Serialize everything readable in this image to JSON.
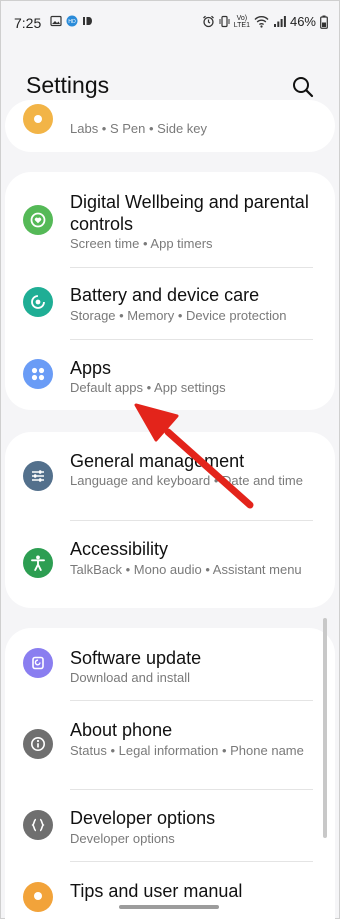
{
  "status_bar": {
    "time": "7:25",
    "battery": "46%",
    "volte_top": "Vo)",
    "volte_bottom": "LTE1"
  },
  "header": {
    "title": "Settings",
    "search_icon": "search-icon"
  },
  "partial_row": {
    "subtitle": "Labs • S Pen • Side key",
    "icon_color": "#f2b447"
  },
  "card1": {
    "items": [
      {
        "title": "Digital Wellbeing and parental controls",
        "subtitle": "Screen time • App timers",
        "icon": "wellbeing-icon",
        "color": "#55b957"
      },
      {
        "title": "Battery and device care",
        "subtitle": "Storage • Memory • Device protection",
        "icon": "device-care-icon",
        "color": "#1fae95"
      },
      {
        "title": "Apps",
        "subtitle": "Default apps • App settings",
        "icon": "apps-icon",
        "color": "#6a9cf6"
      }
    ]
  },
  "card2": {
    "items": [
      {
        "title": "General management",
        "subtitle": "Language and keyboard • Date and time",
        "icon": "general-management-icon",
        "color": "#53708c"
      },
      {
        "title": "Accessibility",
        "subtitle": "TalkBack • Mono audio • Assistant menu",
        "icon": "accessibility-icon",
        "color": "#2d9e52"
      }
    ]
  },
  "card3": {
    "items": [
      {
        "title": "Software update",
        "subtitle": "Download and install",
        "icon": "software-update-icon",
        "color": "#8a7ef0"
      },
      {
        "title": "About phone",
        "subtitle": "Status • Legal information • Phone name",
        "icon": "about-phone-icon",
        "color": "#6f6f6f"
      },
      {
        "title": "Developer options",
        "subtitle": "Developer options",
        "icon": "developer-options-icon",
        "color": "#6f6f6f"
      },
      {
        "title": "Tips and user manual",
        "subtitle": "",
        "icon": "tips-icon",
        "color": "#f2a33a"
      }
    ]
  },
  "annotation": {
    "arrow_color": "#e3241b",
    "arrow_icon": "red-arrow-annotation"
  }
}
